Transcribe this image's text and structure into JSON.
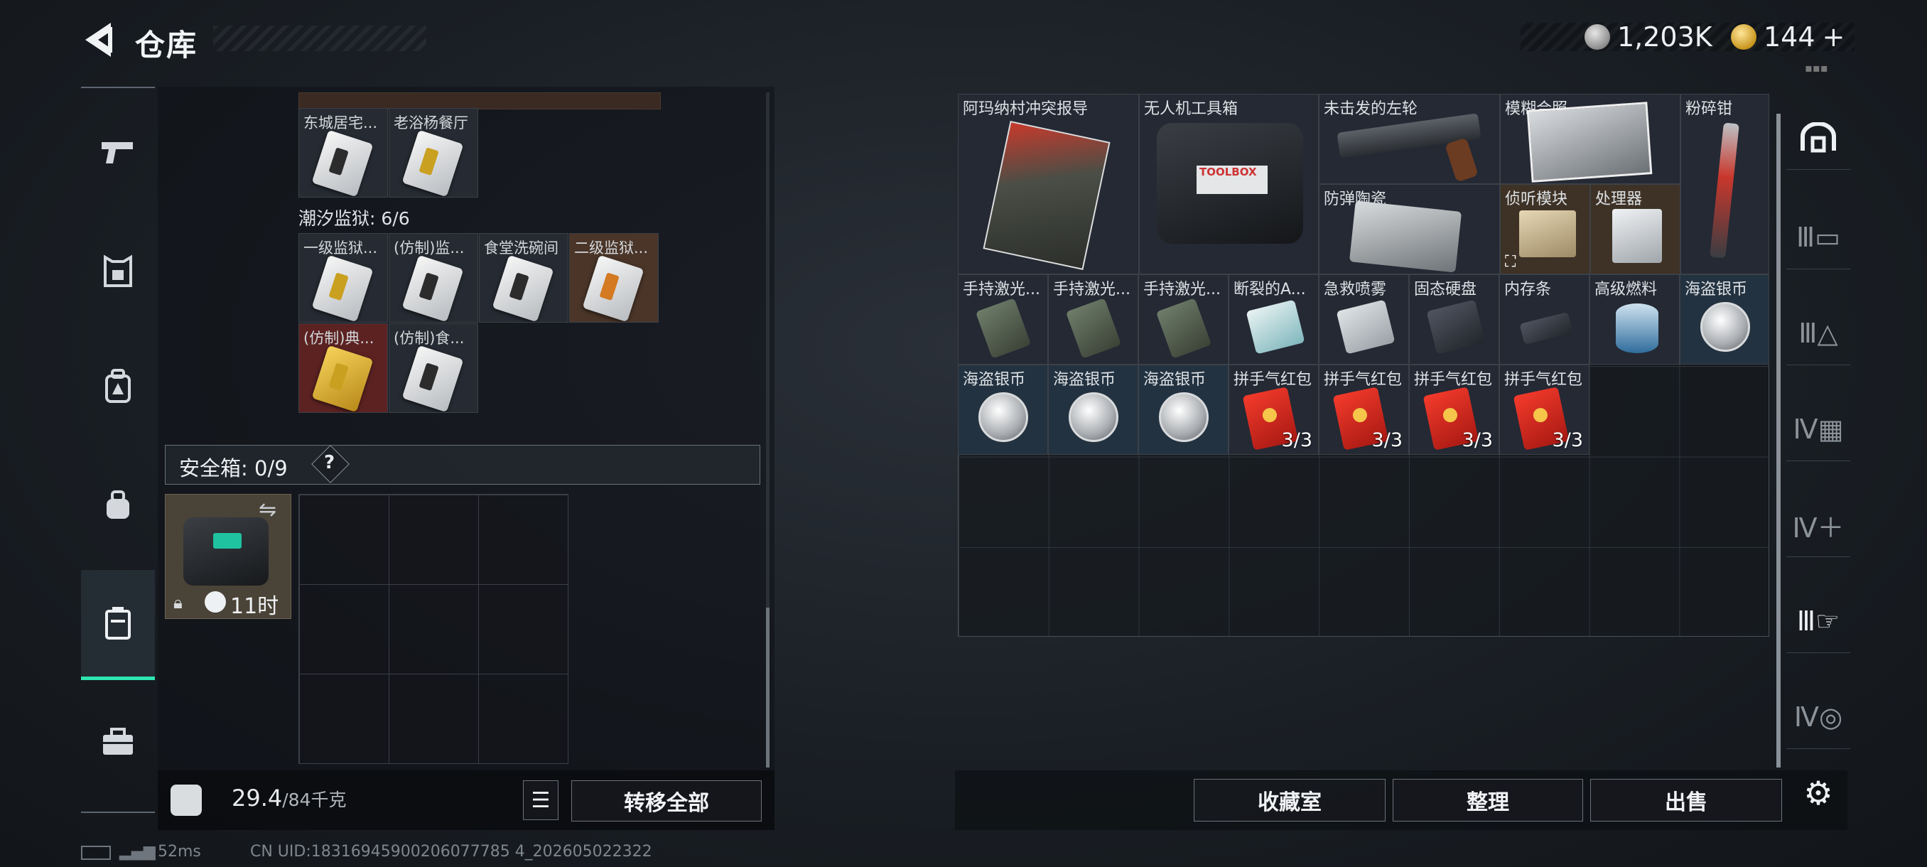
{
  "header": {
    "title": "仓库",
    "currency_silver": "1,203K",
    "currency_gold": "144",
    "gold_plus": "+"
  },
  "left_sidebar": [
    "gun-icon",
    "armor-icon",
    "backpack-icon",
    "bag-icon",
    "case-icon",
    "toolbox-icon"
  ],
  "left_panel": {
    "top_row": [
      {
        "label": "东城居宅..."
      },
      {
        "label": "老浴杨餐厅"
      }
    ],
    "prison_section": "潮汐监狱: 6/6",
    "prison_row1": [
      {
        "label": "一级监狱..."
      },
      {
        "label": "(仿制)监..."
      },
      {
        "label": "食堂洗碗间"
      },
      {
        "label": "二级监狱..."
      }
    ],
    "prison_row2": [
      {
        "label": "(仿制)典..."
      },
      {
        "label": "(仿制)食..."
      }
    ],
    "safebox_label": "安全箱: 0/9",
    "safebox_help": "?",
    "case_timer": "11时",
    "weight_value": "29.4",
    "weight_max": "/84千克",
    "transfer_all": "转移全部"
  },
  "right_grid": {
    "items": [
      {
        "label": "阿玛纳村冲突报导"
      },
      {
        "label": "无人机工具箱"
      },
      {
        "label": "未击发的左轮"
      },
      {
        "label": "模糊合照"
      },
      {
        "label": "粉碎钳"
      },
      {
        "label": "防弹陶瓷"
      },
      {
        "label": "侦听模块"
      },
      {
        "label": "处理器"
      },
      {
        "label": "手持激光..."
      },
      {
        "label": "手持激光..."
      },
      {
        "label": "手持激光..."
      },
      {
        "label": "断裂的A..."
      },
      {
        "label": "急救喷雾"
      },
      {
        "label": "固态硬盘"
      },
      {
        "label": "内存条"
      },
      {
        "label": "高级燃料"
      },
      {
        "label": "海盗银币"
      },
      {
        "label": "海盗银币"
      },
      {
        "label": "海盗银币"
      },
      {
        "label": "海盗银币"
      },
      {
        "label": "拼手气红包",
        "count": "3/3"
      },
      {
        "label": "拼手气红包",
        "count": "3/3"
      },
      {
        "label": "拼手气红包",
        "count": "3/3"
      },
      {
        "label": "拼手气红包",
        "count": "3/3"
      }
    ],
    "toolbox_text": "TOOLBOX"
  },
  "bottom_buttons": {
    "collection": "收藏室",
    "organize": "整理",
    "sell": "出售"
  },
  "right_sidebar": [
    "shelter-icon",
    "storage-III-icon",
    "storage-III-warn-icon",
    "storage-IV-icon",
    "storage-IV-add-icon",
    "storage-III-select-icon",
    "storage-IV-alt-icon",
    "settings-gear-icon"
  ],
  "status_bar": {
    "ping": "52ms",
    "uid": "CN UID:18316945900206077785 4_202605022322"
  },
  "colors": {
    "accent": "#2ee6b2",
    "silver_cell": "#233240",
    "brown_cell": "#3e3226"
  }
}
